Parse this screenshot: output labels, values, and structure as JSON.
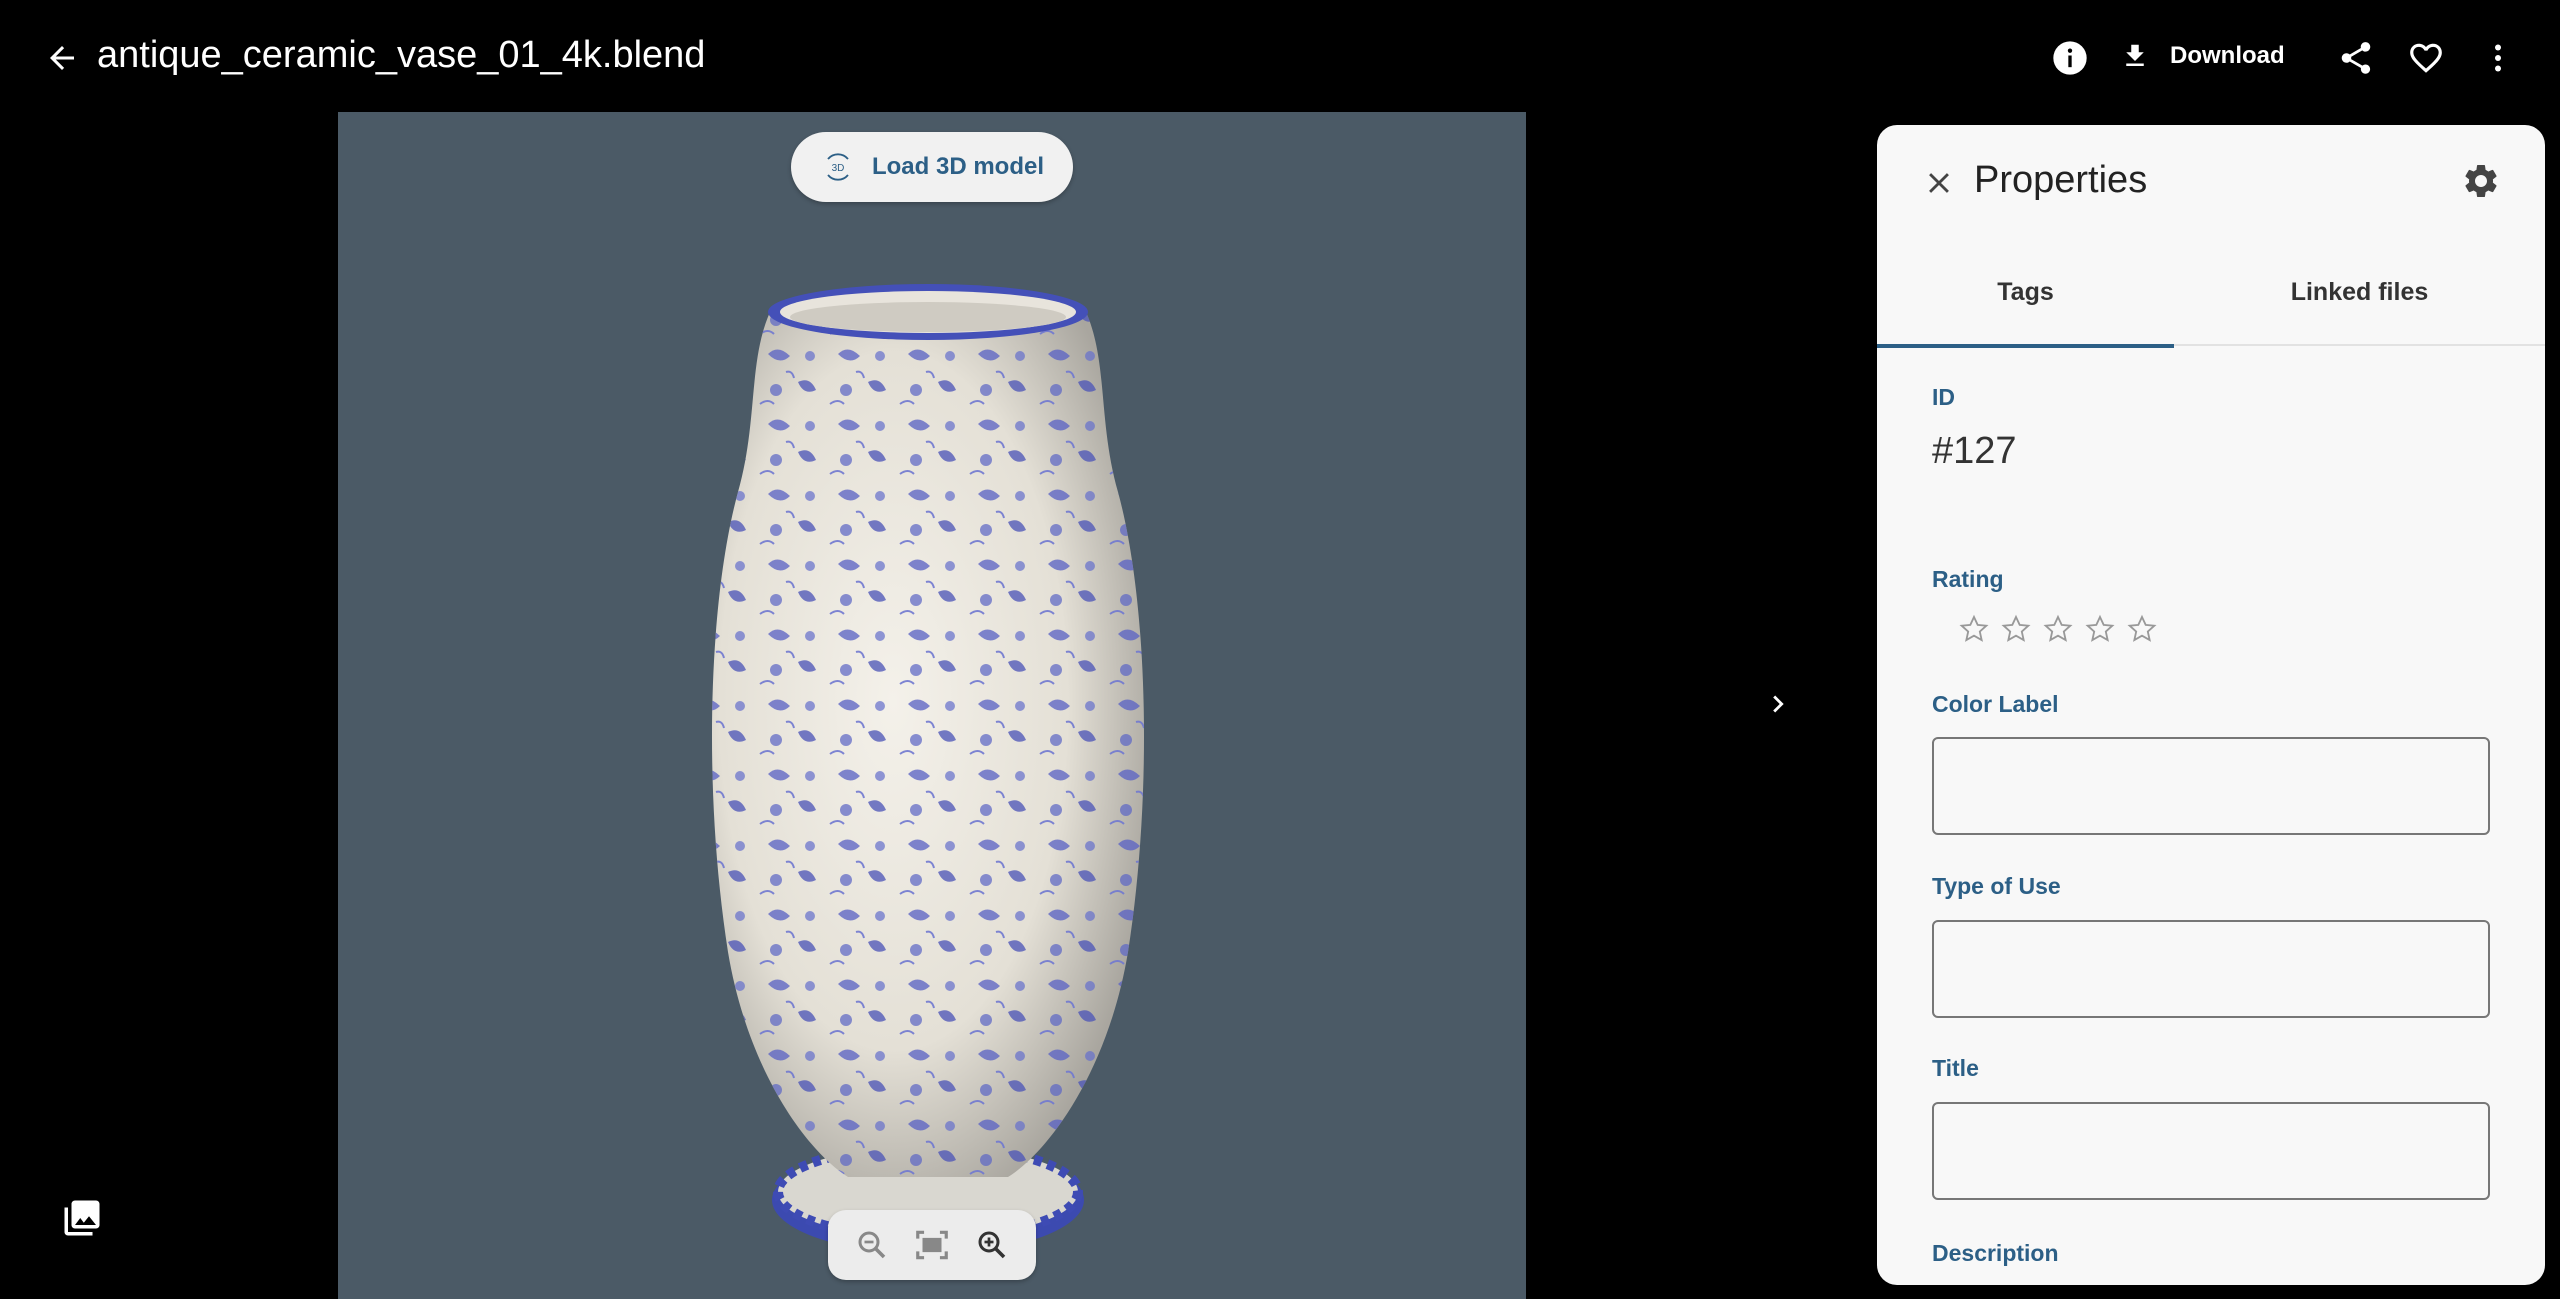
{
  "header": {
    "file_name": "antique_ceramic_vase_01_4k.blend",
    "download_label": "Download",
    "icons": [
      "arrow-back-icon",
      "info-icon",
      "download-icon",
      "share-icon",
      "heart-icon",
      "more-vert-icon"
    ]
  },
  "viewer": {
    "load_3d_label": "Load 3D model",
    "load_3d_badge": "3D",
    "background_color": "#4b5a66",
    "zoom_controls": [
      "zoom-out-icon",
      "fit-screen-icon",
      "zoom-in-icon"
    ]
  },
  "properties": {
    "title": "Properties",
    "tabs": [
      {
        "label": "Tags",
        "active": true
      },
      {
        "label": "Linked files",
        "active": false
      }
    ],
    "id_label": "ID",
    "id_value": "#127",
    "rating_label": "Rating",
    "rating_value": 0,
    "rating_max": 5,
    "color_label_label": "Color Label",
    "color_label_value": "",
    "type_of_use_label": "Type of Use",
    "type_of_use_value": "",
    "title_label": "Title",
    "title_value": "",
    "description_label": "Description",
    "accent_color": "#2c5f86"
  }
}
